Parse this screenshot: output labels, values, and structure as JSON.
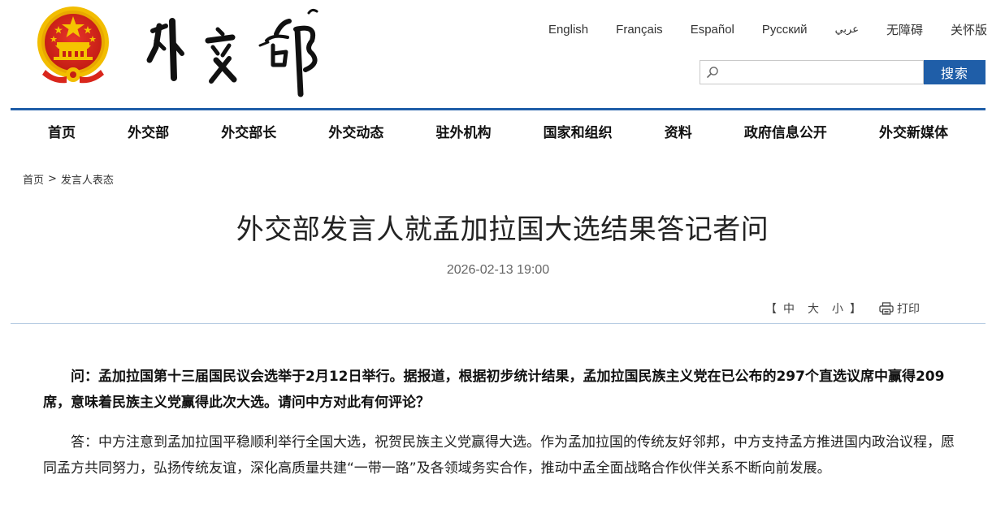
{
  "header": {
    "languages": [
      {
        "label": "English"
      },
      {
        "label": "Français"
      },
      {
        "label": "Español"
      },
      {
        "label": "Русский"
      },
      {
        "label": "عربي"
      },
      {
        "label": "无障碍"
      },
      {
        "label": "关怀版"
      }
    ],
    "search": {
      "placeholder": "",
      "value": "",
      "button_label": "搜索"
    },
    "colors": {
      "brand_blue": "#1f5ea8",
      "emblem_red": "#d9261c",
      "emblem_gold": "#f5c400"
    },
    "emblem_icon": "national-emblem-icon",
    "calligraphy_logo": "外交部"
  },
  "nav": {
    "items": [
      {
        "label": "首页"
      },
      {
        "label": "外交部"
      },
      {
        "label": "外交部长"
      },
      {
        "label": "外交动态"
      },
      {
        "label": "驻外机构"
      },
      {
        "label": "国家和组织"
      },
      {
        "label": "资料"
      },
      {
        "label": "政府信息公开"
      },
      {
        "label": "外交新媒体"
      }
    ]
  },
  "breadcrumb": {
    "items": [
      {
        "label": "首页"
      },
      {
        "label": "发言人表态"
      }
    ],
    "separator": ">"
  },
  "article": {
    "title": "外交部发言人就孟加拉国大选结果答记者问",
    "date": "2026-02-13 19:00",
    "tools": {
      "bracket_open": "【",
      "size_large": "中",
      "size_medium": "大",
      "size_small": "小",
      "bracket_close": "】",
      "print_label": "打印",
      "print_icon": "printer-icon"
    },
    "paragraphs": [
      {
        "type": "question",
        "text": "问：孟加拉国第十三届国民议会选举于2月12日举行。据报道，根据初步统计结果，孟加拉国民族主义党在已公布的297个直选议席中赢得209席，意味着民族主义党赢得此次大选。请问中方对此有何评论？"
      },
      {
        "type": "answer",
        "text": "答：中方注意到孟加拉国平稳顺利举行全国大选，祝贺民族主义党赢得大选。作为孟加拉国的传统友好邻邦，中方支持孟方推进国内政治议程，愿同孟方共同努力，弘扬传统友谊，深化高质量共建“一带一路”及各领域务实合作，推动中孟全面战略合作伙伴关系不断向前发展。"
      }
    ]
  }
}
